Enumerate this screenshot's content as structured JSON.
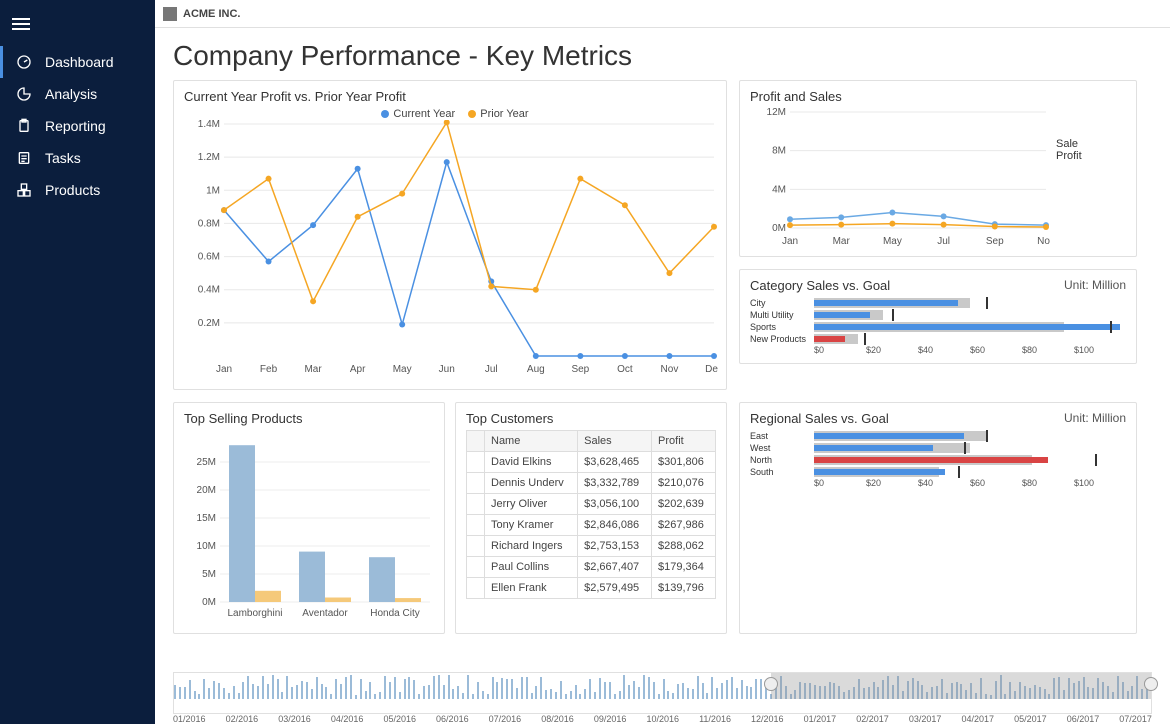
{
  "brand": "ACME INC.",
  "sidebar": {
    "items": [
      {
        "label": "Dashboard",
        "icon": "gauge",
        "active": true
      },
      {
        "label": "Analysis",
        "icon": "pie"
      },
      {
        "label": "Reporting",
        "icon": "clipboard"
      },
      {
        "label": "Tasks",
        "icon": "checklist"
      },
      {
        "label": "Products",
        "icon": "boxes"
      }
    ]
  },
  "page": {
    "title": "Company Performance - Key Metrics"
  },
  "cards": {
    "profitLine": {
      "title": "Current Year Profit vs. Prior Year Profit",
      "legend": [
        "Current Year",
        "Prior Year"
      ]
    },
    "profitSales": {
      "title": "Profit and Sales",
      "legend": [
        "Sale",
        "Profit"
      ]
    },
    "categorySales": {
      "title": "Category Sales vs. Goal",
      "unit": "Unit: Million"
    },
    "topProducts": {
      "title": "Top Selling Products"
    },
    "topCustomers": {
      "title": "Top Customers",
      "cols": [
        "Name",
        "Sales",
        "Profit"
      ]
    },
    "regionalSales": {
      "title": "Regional Sales vs. Goal",
      "unit": "Unit: Million"
    }
  },
  "timeline": {
    "labels": [
      "01/2016",
      "02/2016",
      "03/2016",
      "04/2016",
      "05/2016",
      "06/2016",
      "07/2016",
      "08/2016",
      "09/2016",
      "10/2016",
      "11/2016",
      "12/2016",
      "01/2017",
      "02/2017",
      "03/2017",
      "04/2017",
      "05/2017",
      "06/2017",
      "07/2017"
    ]
  },
  "customers": [
    {
      "name": "David Elkins",
      "sales": "$3,628,465",
      "profit": "$301,806"
    },
    {
      "name": "Dennis Underv",
      "sales": "$3,332,789",
      "profit": "$210,076"
    },
    {
      "name": "Jerry Oliver",
      "sales": "$3,056,100",
      "profit": "$202,639"
    },
    {
      "name": "Tony Kramer",
      "sales": "$2,846,086",
      "profit": "$267,986"
    },
    {
      "name": "Richard Ingers",
      "sales": "$2,753,153",
      "profit": "$288,062"
    },
    {
      "name": "Paul Collins",
      "sales": "$2,667,407",
      "profit": "$179,364"
    },
    {
      "name": "Ellen Frank",
      "sales": "$2,579,495",
      "profit": "$139,796"
    }
  ],
  "chart_data": [
    {
      "id": "profit_cy_vs_py",
      "type": "line",
      "title": "Current Year Profit vs. Prior Year Profit",
      "x": [
        "Jan",
        "Feb",
        "Mar",
        "Apr",
        "May",
        "Jun",
        "Jul",
        "Aug",
        "Sep",
        "Oct",
        "Nov",
        "Dec"
      ],
      "ylim": [
        0,
        1400000
      ],
      "yticks": [
        "0.2M",
        "0.4M",
        "0.6M",
        "0.8M",
        "1M",
        "1.2M",
        "1.4M"
      ],
      "series": [
        {
          "name": "Current Year",
          "color": "#4a90e2",
          "values": [
            880000,
            570000,
            790000,
            1130000,
            190000,
            1170000,
            450000,
            0,
            0,
            0,
            0,
            0
          ]
        },
        {
          "name": "Prior Year",
          "color": "#f5a623",
          "values": [
            880000,
            1070000,
            330000,
            840000,
            980000,
            1410000,
            420000,
            400000,
            1070000,
            910000,
            500000,
            780000
          ]
        }
      ]
    },
    {
      "id": "profit_and_sales",
      "type": "line",
      "title": "Profit and Sales",
      "x": [
        "Jan",
        "Mar",
        "May",
        "Jul",
        "Sep",
        "Nov"
      ],
      "ylim": [
        0,
        12000000
      ],
      "yticks": [
        "0M",
        "4M",
        "8M",
        "12M"
      ],
      "series": [
        {
          "name": "Sale",
          "color": "#6aa9e4",
          "values": [
            900000,
            1100000,
            1600000,
            1200000,
            400000,
            300000
          ]
        },
        {
          "name": "Profit",
          "color": "#f5a623",
          "values": [
            300000,
            350000,
            450000,
            350000,
            150000,
            100000
          ]
        }
      ]
    },
    {
      "id": "category_sales_vs_goal",
      "type": "bar",
      "orientation": "horizontal",
      "title": "Category Sales vs. Goal",
      "xlabel": "$M",
      "xlim": [
        0,
        100
      ],
      "xticks": [
        "$0",
        "$20",
        "$40",
        "$60",
        "$80",
        "$100"
      ],
      "categories": [
        "City",
        "Multi Utility",
        "Sports",
        "New Products"
      ],
      "series": [
        {
          "name": "Goal",
          "color": "#c9c9c9",
          "values": [
            50,
            22,
            80,
            14
          ]
        },
        {
          "name": "Actual",
          "color_by_status": true,
          "values": [
            46,
            18,
            98,
            10
          ],
          "colors": [
            "#4a90e2",
            "#4a90e2",
            "#4a90e2",
            "#d94444"
          ]
        },
        {
          "name": "Target Mark",
          "values": [
            55,
            25,
            95,
            16
          ]
        }
      ]
    },
    {
      "id": "top_selling_products",
      "type": "bar",
      "title": "Top Selling Products",
      "categories": [
        "Lamborghini",
        "Aventador",
        "Honda City"
      ],
      "ylim": [
        0,
        30000000
      ],
      "yticks": [
        "0M",
        "5M",
        "10M",
        "15M",
        "20M",
        "25M"
      ],
      "series": [
        {
          "name": "Sales",
          "color": "#9bbbd8",
          "values": [
            28000000,
            9000000,
            8000000
          ]
        },
        {
          "name": "Profit",
          "color": "#f5c97a",
          "values": [
            2000000,
            800000,
            700000
          ]
        }
      ]
    },
    {
      "id": "top_customers",
      "type": "table",
      "columns": [
        "Name",
        "Sales",
        "Profit"
      ],
      "rows": [
        [
          "David Elkins",
          "$3,628,465",
          "$301,806"
        ],
        [
          "Dennis Underv",
          "$3,332,789",
          "$210,076"
        ],
        [
          "Jerry Oliver",
          "$3,056,100",
          "$202,639"
        ],
        [
          "Tony Kramer",
          "$2,846,086",
          "$267,986"
        ],
        [
          "Richard Ingers",
          "$2,753,153",
          "$288,062"
        ],
        [
          "Paul Collins",
          "$2,667,407",
          "$179,364"
        ],
        [
          "Ellen Frank",
          "$2,579,495",
          "$139,796"
        ]
      ]
    },
    {
      "id": "regional_sales_vs_goal",
      "type": "bar",
      "orientation": "horizontal",
      "title": "Regional Sales vs. Goal",
      "xlabel": "$M",
      "xlim": [
        0,
        100
      ],
      "xticks": [
        "$0",
        "$20",
        "$40",
        "$60",
        "$80",
        "$100"
      ],
      "categories": [
        "East",
        "West",
        "North",
        "South"
      ],
      "series": [
        {
          "name": "Goal",
          "color": "#c9c9c9",
          "values": [
            55,
            50,
            70,
            40
          ]
        },
        {
          "name": "Actual",
          "color_by_status": true,
          "values": [
            48,
            38,
            75,
            42
          ],
          "colors": [
            "#4a90e2",
            "#4a90e2",
            "#d94444",
            "#4a90e2"
          ]
        },
        {
          "name": "Target Mark",
          "values": [
            55,
            48,
            90,
            46
          ]
        }
      ]
    }
  ]
}
